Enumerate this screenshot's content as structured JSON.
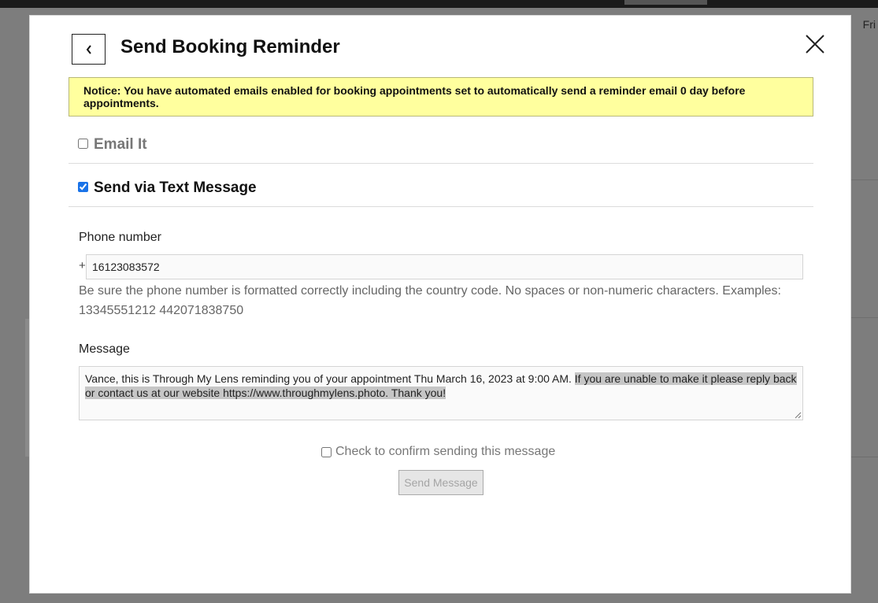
{
  "background": {
    "day_label": "Fri"
  },
  "modal": {
    "title": "Send Booking Reminder",
    "back_icon": "chevron-left-icon",
    "close_icon": "close-icon",
    "notice": "Notice: You have automated emails enabled for booking appointments set to automatically send a reminder email 0 day before appointments.",
    "email_option": {
      "label": "Email It",
      "checked": false
    },
    "sms_option": {
      "label": "Send via Text Message",
      "checked": true
    },
    "phone": {
      "label": "Phone number",
      "prefix": "+",
      "value": "16123083572",
      "help": "Be sure the phone number is formatted correctly including the country code. No spaces or non-numeric characters. Examples: 13345551212 442071838750"
    },
    "message": {
      "label": "Message",
      "text_unselected": "Vance, this is Through My Lens reminding you of your appointment Thu March 16, 2023  at 9:00 AM. ",
      "text_selected": "If you are unable to make it please reply back or contact us at our website https://www.throughmylens.photo. Thank you!"
    },
    "confirm": {
      "label": "Check to confirm sending this message",
      "checked": false
    },
    "send_button": "Send Message"
  },
  "colors": {
    "notice_bg": "#ffff9e",
    "overlay": "#7d7d7d",
    "checkbox_accent": "#1a73e8"
  }
}
